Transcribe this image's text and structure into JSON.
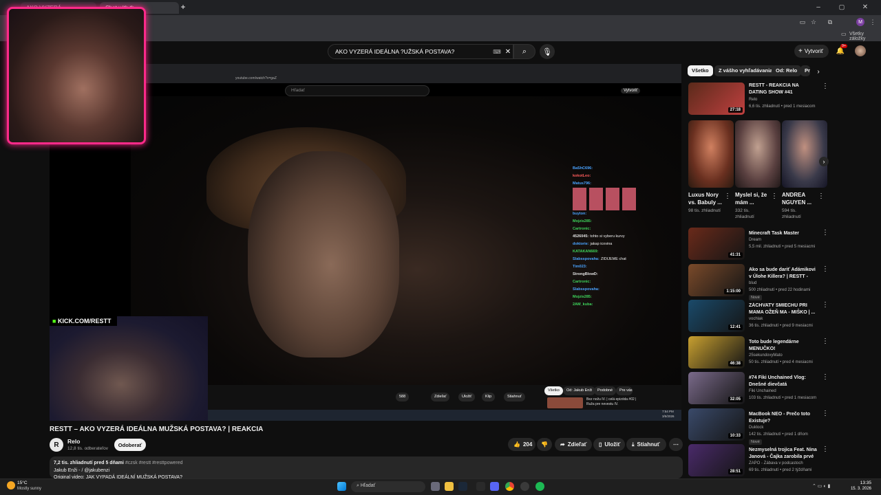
{
  "browser": {
    "tabs": [
      "AKO VYZERÁ ...",
      "Chat with th..."
    ],
    "bookmarks_label": "Všetky záložky"
  },
  "youtube": {
    "search_query": "AKO VYZERÁ IDEÁLNA ?UŽSKÁ POSTAVA?",
    "create_label": "Vytvoriť",
    "notif_count": "9+"
  },
  "inner_player": {
    "url": "youtube.com/watch?v=gaZ",
    "search_placeholder": "Hľadať",
    "create_label": "Vytvoriť",
    "buttons": [
      "588",
      "Zdieľať",
      "Uložiť",
      "Klip",
      "Stiahnuť"
    ],
    "chips": [
      "Všetko",
      "Od: Jakub Enži",
      "Podobné",
      "Pre vás"
    ],
    "related_title": "Bez nožu IV. | celá epizóda #02 | Ruža pre nevestu IV.",
    "time": "7:54 PM",
    "date": "3/5/2026"
  },
  "kick_overlay": "KICK.COM/RESTT",
  "chat": [
    {
      "user": "BaShC696:",
      "msg": "",
      "color": "#4aa3ff"
    },
    {
      "user": "kokotLeo:",
      "msg": "",
      "color": "#ff5c5c"
    },
    {
      "user": "Matus796:",
      "msg": "",
      "color": "#4aa3ff"
    },
    {
      "user": "buyton:",
      "msg": "",
      "color": "#4aa3ff"
    },
    {
      "user": "Mojzis285:",
      "msg": "",
      "color": "#3fd65c"
    },
    {
      "user": "Cartronic:",
      "msg": "",
      "color": "#3fd65c"
    },
    {
      "user": "4526045:",
      "msg": "tohto si vyberu kurvy",
      "color": "#e0e0e0"
    },
    {
      "user": "doktorie:",
      "msg": "jakap icovina",
      "color": "#4aa3ff"
    },
    {
      "user": "KATAKAN669:",
      "msg": "",
      "color": "#3fd65c"
    },
    {
      "user": "Slabsspovaha:",
      "msg": "ZIDIJEME chat",
      "color": "#4aa3ff"
    },
    {
      "user": "Tim023:",
      "msg": "",
      "color": "#4aa3ff"
    },
    {
      "user": "StrongBlowD:",
      "msg": "",
      "color": "#e0e0e0"
    },
    {
      "user": "Cartronic:",
      "msg": "",
      "color": "#3fd65c"
    },
    {
      "user": "Slabsspovaha:",
      "msg": "",
      "color": "#4aa3ff"
    },
    {
      "user": "Mojzis285:",
      "msg": "",
      "color": "#3fd65c"
    },
    {
      "user": "2AM_kuba:",
      "msg": "",
      "color": "#3fd65c"
    }
  ],
  "video": {
    "title": "RESTT – AKO VYZERÁ IDEÁLNA MUŽSKÁ POSTAVA? | REAKCIA",
    "channel": "Relo",
    "subscribers": "12,8 tis. odberateľov",
    "subscribe_label": "Odoberať",
    "likes": "204",
    "share_label": "Zdieľať",
    "save_label": "Uložiť",
    "download_label": "Stiahnuť",
    "views_line": "7,2 tis. zhliadnutí  pred 5 dňami",
    "hashtags": "#czsk #restt #resttpowered",
    "desc_line1": "Jakub Enži -  / @jakubenzi",
    "desc_line2": "Original video:  JAK VYPADÁ IDEÁLNÍ MUŽSKÁ POSTAVA?"
  },
  "sidebar": {
    "chips": [
      "Všetko",
      "Z vášho vyhľadávania",
      "Od: Relo",
      "Pr"
    ],
    "first": {
      "title": "RESTT - REAKCIA NA DATING SHOW #41",
      "channel": "Relo",
      "meta": "6,6 tis. zhliadnutí • pred 1 mesiacom",
      "duration": "27:18"
    },
    "shorts": [
      {
        "title": "Luxus Nory vs. Babuly ...",
        "meta": "98 tis. zhliadnutí"
      },
      {
        "title": "Myslel si, že mám ...",
        "meta": "332 tis. zhliadnutí"
      },
      {
        "title": "ANDREA NGUYEN ...",
        "meta": "594 tis. zhliadnutí"
      }
    ],
    "videos": [
      {
        "title": "Minecraft Task Master",
        "channel": "Dream",
        "meta": "5,5 mil. zhliadnutí • pred 5 mesiacmi",
        "duration": "41:31",
        "new": ""
      },
      {
        "title": "Ako sa bude dariť Adámikovi v Úlohe Killera? | RESTT - Goose...",
        "channel": "blud",
        "meta": "500 zhliadnutí • pred 22 hodinami",
        "duration": "1:15:00",
        "new": "Nové"
      },
      {
        "title": "ZÁCHVATY SMIECHU PRI MAMA OŽEŇ MA - MIŠKO | ...",
        "channel": "vochlak",
        "meta": "36 tis. zhliadnutí • pred 9 mesiacmi",
        "duration": "12:41",
        "new": ""
      },
      {
        "title": "Toto bude legendárne MENUČKO!",
        "channel": "25sekundovyMato",
        "meta": "50 tis. zhliadnutí • pred 4 mesiacmi",
        "duration": "46:38",
        "new": ""
      },
      {
        "title": "#74 Fiki Unchained Vlog: Dnešné dievčatá",
        "channel": "Fiki Unchained",
        "meta": "103 tis. zhliadnutí • pred 1 mesiacom",
        "duration": "32:05",
        "new": ""
      },
      {
        "title": "MacBook NEO - Prečo toto Existuje?",
        "channel": "Duklock",
        "meta": "142 tis. zhliadnutí • pred 1 dňom",
        "duration": "10:33",
        "new": "Nové"
      },
      {
        "title": "Nezmyselná trojica Feat. Nina Janová - Čajka zarobila prvé ...",
        "channel": "ZAPO - Zábava v podcastoch",
        "meta": "69 tis. zhliadnutí • pred 2 týždňami",
        "duration": "28:51",
        "new": ""
      }
    ],
    "thumb_colors": [
      "#6a2a1a",
      "#7a4a2a",
      "#1a4a6a",
      "#c8a030",
      "#7a6a8a",
      "#3a4a6a",
      "#4a2a6a"
    ]
  },
  "taskbar": {
    "weather_temp": "15°C",
    "weather_desc": "Mostly sunny",
    "search_placeholder": "Hľadať",
    "time": "13:35",
    "date": "15. 3. 2026"
  }
}
